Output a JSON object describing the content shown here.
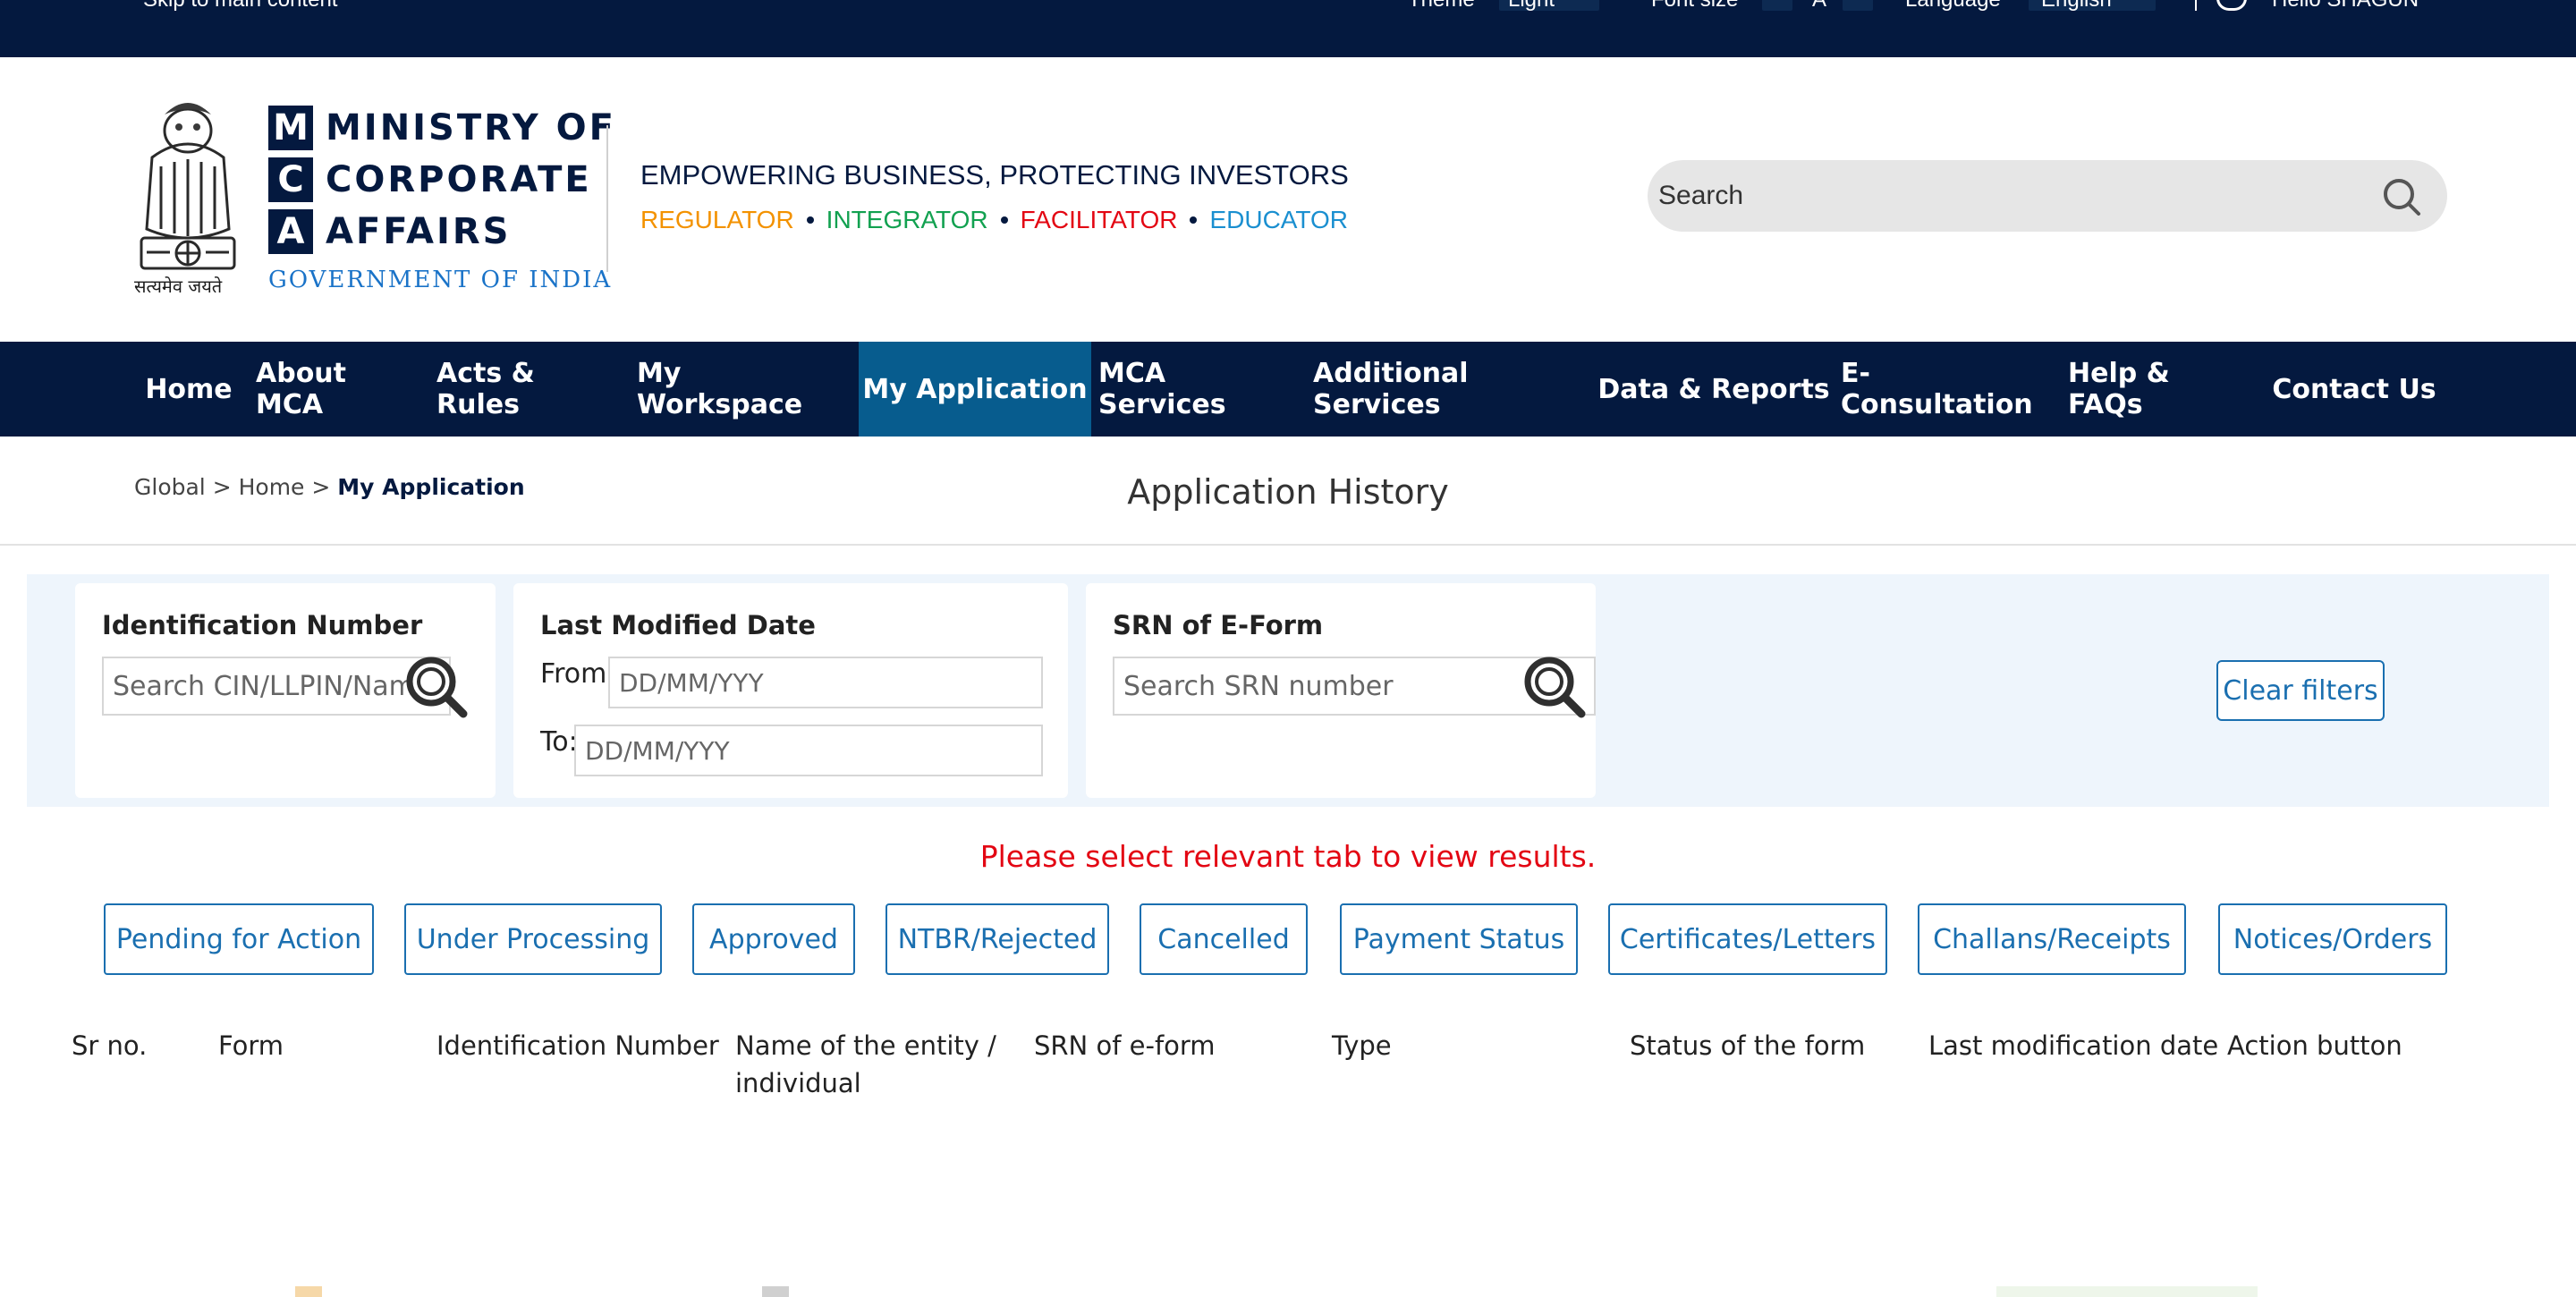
{
  "topbar": {
    "skip_label": "Skip to main content",
    "theme_label": "Theme",
    "theme_value": "Light",
    "fontsize_label": "Font size",
    "fontsize_normal": "A",
    "language_label": "Language",
    "language_value": "English",
    "user_greeting": "Hello SHAGUN"
  },
  "header": {
    "emblem_caption": "सत्यमेव जयते",
    "mca_letters": [
      "M",
      "C",
      "A"
    ],
    "mca_words": [
      "MINISTRY OF",
      "CORPORATE",
      "AFFAIRS"
    ],
    "gov": "GOVERNMENT OF INDIA",
    "tagline": "EMPOWERING BUSINESS, PROTECTING INVESTORS",
    "roles": [
      {
        "label": "REGULATOR",
        "color": "#f39200"
      },
      {
        "label": "INTEGRATOR",
        "color": "#12a150"
      },
      {
        "label": "FACILITATOR",
        "color": "#e30613"
      },
      {
        "label": "EDUCATOR",
        "color": "#1a8fd0"
      }
    ],
    "search_placeholder": "Search"
  },
  "nav": {
    "items": [
      {
        "label": "Home",
        "active": false
      },
      {
        "label": "About MCA",
        "active": false
      },
      {
        "label": "Acts & Rules",
        "active": false
      },
      {
        "label": "My Workspace",
        "active": false
      },
      {
        "label": "My Application",
        "active": true
      },
      {
        "label": "MCA Services",
        "active": false
      },
      {
        "label": "Additional Services",
        "active": false
      },
      {
        "label": "Data & Reports",
        "active": false
      },
      {
        "label": "E-Consultation",
        "active": false
      },
      {
        "label": "Help & FAQs",
        "active": false
      },
      {
        "label": "Contact Us",
        "active": false
      }
    ]
  },
  "breadcrumb": {
    "items": [
      "Global",
      "Home"
    ],
    "current": "My Application",
    "separator": ">"
  },
  "page_title": "Application History",
  "filters": {
    "identification": {
      "label": "Identification Number",
      "placeholder": "Search CIN/LLPIN/Name"
    },
    "date": {
      "label": "Last Modified Date",
      "from_label": "From:",
      "to_label": "To:",
      "placeholder": "DD/MM/YYY"
    },
    "srn": {
      "label": "SRN of E-Form",
      "placeholder": "Search SRN number"
    },
    "clear_label": "Clear filters"
  },
  "notice": "Please select relevant tab to view results.",
  "tabs": [
    "Pending for Action",
    "Under Processing",
    "Approved",
    "NTBR/Rejected",
    "Cancelled",
    "Payment Status",
    "Certificates/Letters",
    "Challans/Receipts",
    "Notices/Orders"
  ],
  "table": {
    "columns": [
      "Sr no.",
      "Form",
      "Identification Number",
      "Name of the entity / individual",
      "SRN of e-form",
      "Type",
      "Status of the form",
      "Last modification date",
      "Action button"
    ]
  },
  "colors": {
    "navy": "#04193f",
    "active_nav": "#075c8e",
    "accent_blue": "#1a6fb0",
    "alert_red": "#e30613"
  }
}
